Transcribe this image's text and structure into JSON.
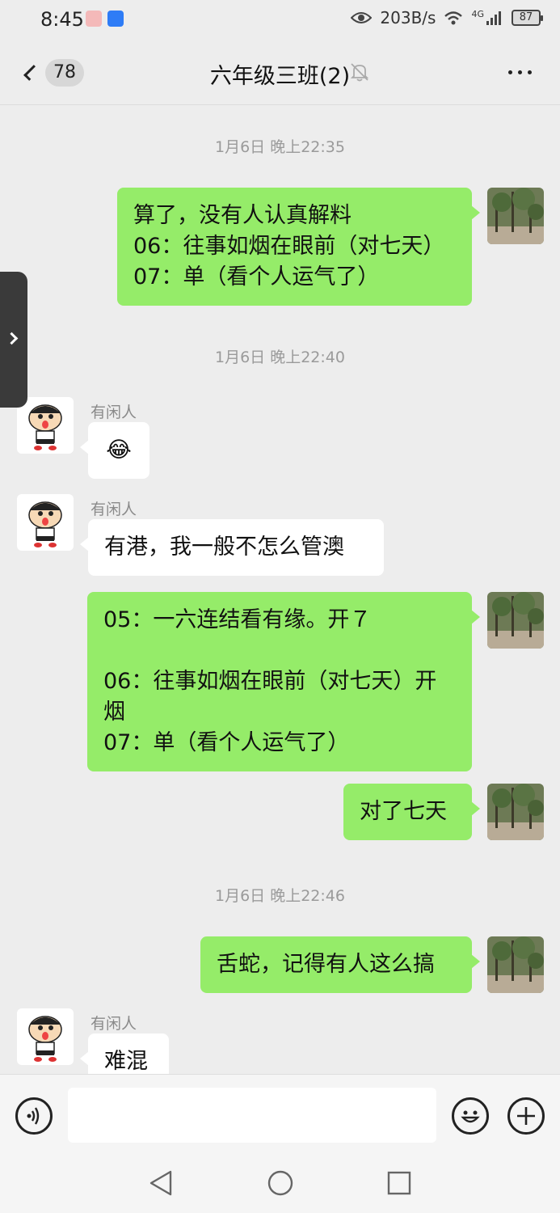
{
  "status_bar": {
    "time": "8:45",
    "net_speed": "203B/s",
    "network": "4G",
    "battery": "87"
  },
  "header": {
    "back_count": "78",
    "title": "六年级三班(2)"
  },
  "messages": [
    {
      "kind": "timestamp",
      "text": "1月6日 晚上22:35"
    },
    {
      "kind": "outgoing",
      "text": "算了，没有人认真解料\n06：往事如烟在眼前（对七天）\n07：单（看个人运气了）"
    },
    {
      "kind": "timestamp",
      "text": "1月6日 晚上22:40"
    },
    {
      "kind": "incoming",
      "sender": "有闲人",
      "text": "😂"
    },
    {
      "kind": "incoming",
      "sender": "有闲人",
      "text": "有港，我一般不怎么管澳"
    },
    {
      "kind": "outgoing",
      "text": "05：一六连结看有缘。开７\n\n06：往事如烟在眼前（对七天）开烟\n07：单（看个人运气了）"
    },
    {
      "kind": "outgoing",
      "text": "对了七天"
    },
    {
      "kind": "timestamp",
      "text": "1月6日 晚上22:46"
    },
    {
      "kind": "outgoing",
      "text": "舌蛇，记得有人这么搞"
    },
    {
      "kind": "incoming",
      "sender": "有闲人",
      "text": "难混"
    }
  ],
  "input": {
    "placeholder": ""
  },
  "icons": {
    "back": "chevron-left-icon",
    "mute": "bell-off-icon",
    "more": "more-dots-icon",
    "voice": "voice-icon",
    "emoji": "emoji-icon",
    "plus": "plus-icon"
  },
  "colors": {
    "background": "#ededed",
    "outgoing_bubble": "#95ec69",
    "incoming_bubble": "#ffffff",
    "timestamp": "#9a9a9a"
  }
}
